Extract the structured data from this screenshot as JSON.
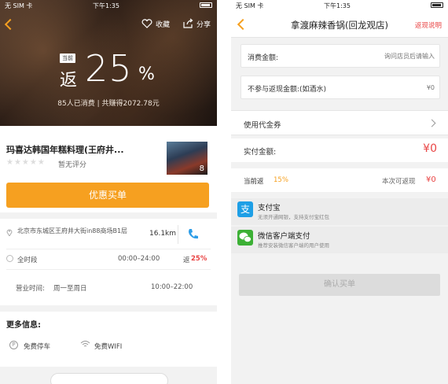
{
  "left": {
    "status": {
      "carrier": "无 SIM 卡",
      "time": "下午1:35"
    },
    "header": {
      "favorite_label": "收藏",
      "share_label": "分享"
    },
    "hero": {
      "now_tag": "当前",
      "fan_label": "返",
      "percent_value": "25",
      "percent_sign": "%",
      "summary": "85人已消费 | 共赚得2072.78元"
    },
    "shop": {
      "name": "玛喜达韩国年糕料理(王府井...",
      "rating_text": "暂无评分",
      "photo_count": "8",
      "buy_label": "优惠买单"
    },
    "info": {
      "address": "北京市东城区王府井大街in88商场B1层",
      "distance": "16.1km",
      "slot_label": "全时段",
      "slot_time": "00:00–24:00",
      "slot_fan_label": "返",
      "slot_fan_pct": "25%",
      "hours_label": "营业时间:",
      "hours_days": "周一至周日",
      "hours_time": "10:00–22:00"
    },
    "more": {
      "title": "更多信息:",
      "parking": "免费停车",
      "parking_icon_glyph": "P",
      "wifi": "免费WIFI"
    }
  },
  "right": {
    "status": {
      "carrier": "无 SIM 卡",
      "time": "下午1:35"
    },
    "header": {
      "title": "拿渡麻辣香锅(回龙观店)",
      "rebate_note": "返现说明"
    },
    "form": {
      "amount_label": "消费金额:",
      "amount_placeholder": "询问店员后请输入",
      "excluded_label": "不参与返现金额:(如酒水)",
      "excluded_placeholder": "¥0"
    },
    "coupon_label": "使用代金券",
    "paid_label": "实付金额:",
    "paid_value": "¥0",
    "rebate": {
      "label": "当前返",
      "pct": "15%",
      "hint": "本次可返现",
      "value": "¥0"
    },
    "payments": [
      {
        "title": "支付宝",
        "subtitle": "无须开通网银，支持支付宝红包",
        "icon": "alipay-icon",
        "glyph": "支",
        "color": "#1e9fe6"
      },
      {
        "title": "微信客户端支付",
        "subtitle": "推荐安装微信客户端的用户使用",
        "icon": "wechat-icon",
        "color": "#3cb035"
      }
    ],
    "confirm_label": "确认买单"
  },
  "colors": {
    "accent_orange": "#f6a020",
    "accent_red": "#e94545",
    "alipay_blue": "#1e9fe6",
    "wechat_green": "#3cb035"
  }
}
